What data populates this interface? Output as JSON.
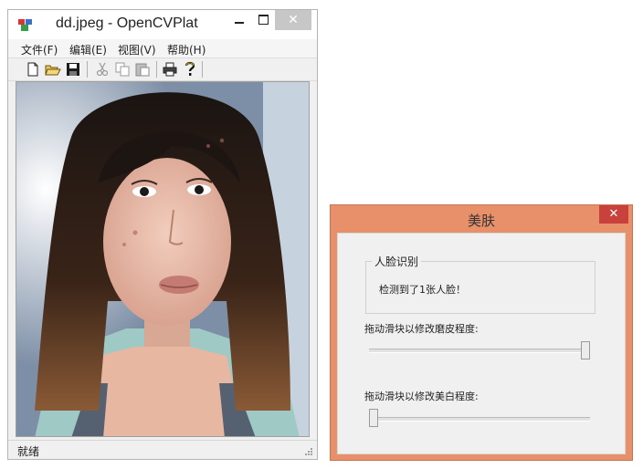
{
  "main_window": {
    "title": "dd.jpeg - OpenCVPlat",
    "close_glyph": "✕",
    "menu": [
      "文件(F)",
      "编辑(E)",
      "视图(V)",
      "帮助(H)"
    ],
    "toolbar_icons": [
      "new-file-icon",
      "open-folder-icon",
      "save-icon",
      "cut-icon",
      "copy-icon",
      "paste-icon",
      "print-icon",
      "help-icon"
    ],
    "status": "就绪"
  },
  "dialog": {
    "title": "美肤",
    "close_glyph": "✕",
    "face_group_label": "人脸识别",
    "face_result": "检测到了1张人脸！",
    "smooth_label": "拖动滑块以修改磨皮程度:",
    "smooth_value": 1.0,
    "whiten_label": "拖动滑块以修改美白程度:",
    "whiten_value": 0.0
  },
  "colors": {
    "dialog_frame": "#e8906a",
    "dialog_close": "#c8413c",
    "window_close": "#c7c7c7"
  }
}
